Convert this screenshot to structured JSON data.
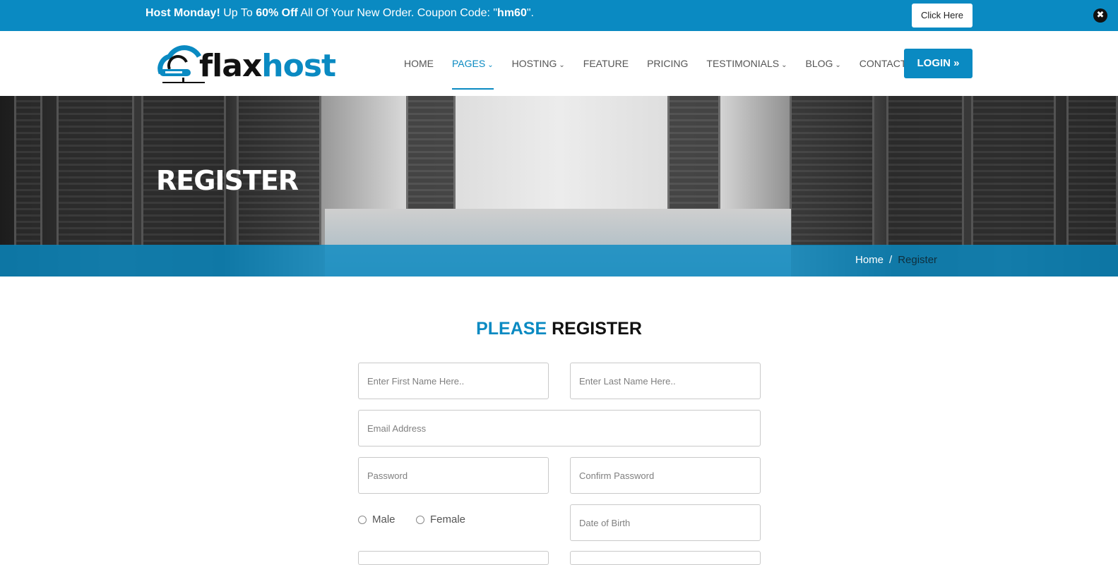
{
  "promo": {
    "part1_bold": "Host Monday!",
    "part2": " Up To ",
    "part3_bold": "60% Off",
    "part4": " All Of Your New Order. Coupon Code: \"",
    "part5_bold": "hm60",
    "part6": "\".",
    "button_label": "Click Here",
    "close_glyph": "✖"
  },
  "header": {
    "logo_flax": "flax",
    "logo_host": "host",
    "nav": [
      {
        "label": "HOME",
        "has_dropdown": false,
        "active": false
      },
      {
        "label": "PAGES",
        "has_dropdown": true,
        "active": true
      },
      {
        "label": "HOSTING",
        "has_dropdown": true,
        "active": false
      },
      {
        "label": "FEATURE",
        "has_dropdown": false,
        "active": false
      },
      {
        "label": "PRICING",
        "has_dropdown": false,
        "active": false
      },
      {
        "label": "TESTIMONIALS",
        "has_dropdown": true,
        "active": false
      },
      {
        "label": "BLOG",
        "has_dropdown": true,
        "active": false
      },
      {
        "label": "CONTACT",
        "has_dropdown": false,
        "active": false
      }
    ],
    "chevron_glyph": "⌄",
    "login_label": "LOGIN",
    "login_icon": "»"
  },
  "banner": {
    "title": "REGISTER",
    "breadcrumb_home": "Home",
    "breadcrumb_sep": "/",
    "breadcrumb_current": "Register"
  },
  "form": {
    "title_part1": "PLEASE",
    "title_part2": "REGISTER",
    "first_name_placeholder": "Enter First Name Here..",
    "last_name_placeholder": "Enter Last Name Here..",
    "email_placeholder": "Email Address",
    "password_placeholder": "Password",
    "confirm_password_placeholder": "Confirm Password",
    "gender_male": "Male",
    "gender_female": "Female",
    "dob_placeholder": "Date of Birth"
  },
  "colors": {
    "accent": "#0a8ac2",
    "dark": "#111111"
  }
}
